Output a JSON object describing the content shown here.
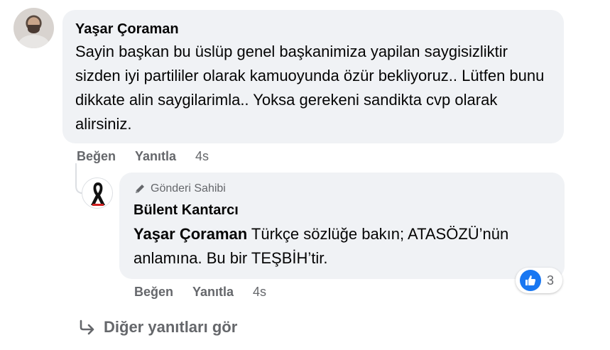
{
  "comment": {
    "author": "Yaşar Çoraman",
    "text": "Sayin başkan bu üslüp genel başkanimiza yapilan saygisizliktir sizden iyi partililer olarak kamuoyunda özür bekliyoruz.. Lütfen bunu dikkate alin saygilarimla.. Yoksa gerekeni sandikta cvp olarak alirsiniz.",
    "actions": {
      "like": "Beğen",
      "reply": "Yanıtla",
      "time": "4s"
    }
  },
  "reply": {
    "badge": "Gönderi Sahibi",
    "author": "Bülent Kantarcı",
    "mention": "Yaşar Çoraman",
    "text": " Türkçe sözlüğe bakın; ATASÖZÜ’nün anlamına. Bu bir TEŞBİH’tir.",
    "actions": {
      "like": "Beğen",
      "reply": "Yanıtla",
      "time": "4s"
    },
    "reaction_count": "3",
    "reaction_icon": "like-icon",
    "reaction_color": "#1877f2"
  },
  "more_replies": "Diğer yanıtları gör"
}
